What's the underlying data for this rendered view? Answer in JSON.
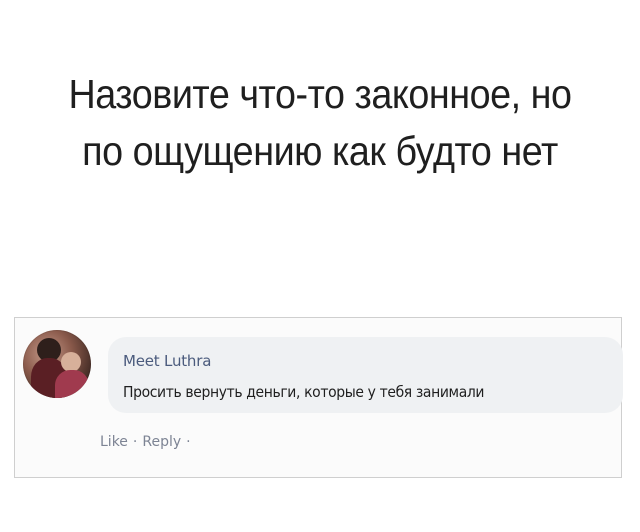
{
  "headline": {
    "line1": "Назовите что-то законное, но",
    "line2": "по ощущению как будто нет"
  },
  "comment": {
    "author": "Meet Luthra",
    "text": "Просить вернуть деньги, которые у тебя занимали",
    "actions": {
      "like": "Like",
      "reply": "Reply",
      "separator": "·"
    }
  },
  "colors": {
    "background": "#ffffff",
    "bubble": "#eff1f3",
    "author": "#4b5b7d",
    "action_text": "#7d8494"
  }
}
